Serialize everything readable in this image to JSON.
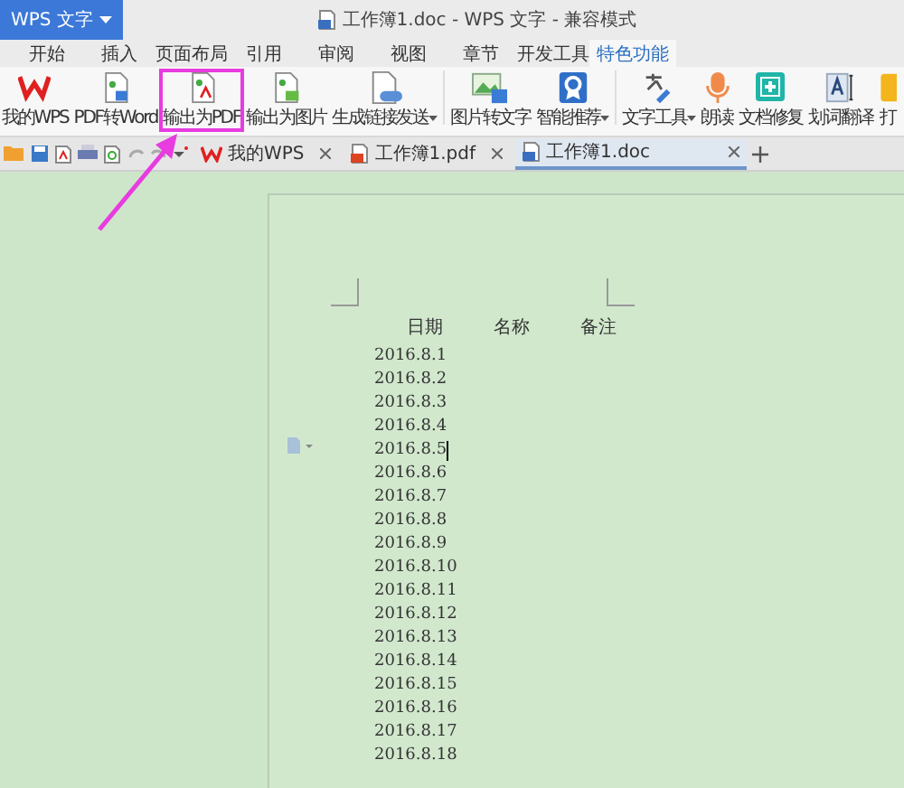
{
  "app_menu": {
    "label": "WPS 文字"
  },
  "window": {
    "title": "工作簿1.doc - WPS 文字 - 兼容模式"
  },
  "menu_tabs": [
    {
      "label": "开始",
      "selected": false
    },
    {
      "label": "插入",
      "selected": false
    },
    {
      "label": "页面布局",
      "selected": false
    },
    {
      "label": "引用",
      "selected": false
    },
    {
      "label": "审阅",
      "selected": false
    },
    {
      "label": "视图",
      "selected": false
    },
    {
      "label": "章节",
      "selected": false
    },
    {
      "label": "开发工具",
      "selected": false
    },
    {
      "label": "特色功能",
      "selected": true
    }
  ],
  "ribbon": [
    {
      "label": "我的WPS",
      "kind": "wps",
      "dropdown": false,
      "highlighted": false
    },
    {
      "label": "PDF转Word",
      "kind": "pdfword",
      "dropdown": false,
      "highlighted": false
    },
    {
      "label": "输出为PDF",
      "kind": "pdf",
      "dropdown": false,
      "highlighted": true
    },
    {
      "label": "输出为图片",
      "kind": "image",
      "dropdown": false,
      "highlighted": false
    },
    {
      "label": "生成链接发送",
      "kind": "link",
      "dropdown": true,
      "highlighted": false
    },
    {
      "label": "图片转文字",
      "kind": "ocr",
      "dropdown": false,
      "highlighted": false
    },
    {
      "label": "智能推荐",
      "kind": "badge",
      "dropdown": true,
      "highlighted": false
    },
    {
      "label": "文字工具",
      "kind": "tools",
      "dropdown": true,
      "highlighted": false
    },
    {
      "label": "朗读",
      "kind": "mic",
      "dropdown": false,
      "highlighted": false
    },
    {
      "label": "文档修复",
      "kind": "repair",
      "dropdown": false,
      "highlighted": false
    },
    {
      "label": "划词翻译",
      "kind": "translate",
      "dropdown": false,
      "highlighted": false
    },
    {
      "label": "打",
      "kind": "print",
      "dropdown": false,
      "highlighted": false
    }
  ],
  "doc_tabs": [
    {
      "label": "我的WPS",
      "kind": "home",
      "selected": false
    },
    {
      "label": "工作簿1.pdf",
      "kind": "pdf",
      "selected": false
    },
    {
      "label": "工作簿1.doc",
      "kind": "doc",
      "selected": true
    }
  ],
  "document": {
    "headers": [
      "日期",
      "名称",
      "备注"
    ],
    "rows": [
      {
        "date": "2016.8.1",
        "caret": false
      },
      {
        "date": "2016.8.2",
        "caret": false
      },
      {
        "date": "2016.8.3",
        "caret": false
      },
      {
        "date": "2016.8.4",
        "caret": false
      },
      {
        "date": "2016.8.5",
        "caret": true
      },
      {
        "date": "2016.8.6",
        "caret": false
      },
      {
        "date": "2016.8.7",
        "caret": false
      },
      {
        "date": "2016.8.8",
        "caret": false
      },
      {
        "date": "2016.8.9",
        "caret": false
      },
      {
        "date": "2016.8.10",
        "caret": false
      },
      {
        "date": "2016.8.11",
        "caret": false
      },
      {
        "date": "2016.8.12",
        "caret": false
      },
      {
        "date": "2016.8.13",
        "caret": false
      },
      {
        "date": "2016.8.14",
        "caret": false
      },
      {
        "date": "2016.8.15",
        "caret": false
      },
      {
        "date": "2016.8.16",
        "caret": false
      },
      {
        "date": "2016.8.17",
        "caret": false
      },
      {
        "date": "2016.8.18",
        "caret": false
      }
    ]
  }
}
